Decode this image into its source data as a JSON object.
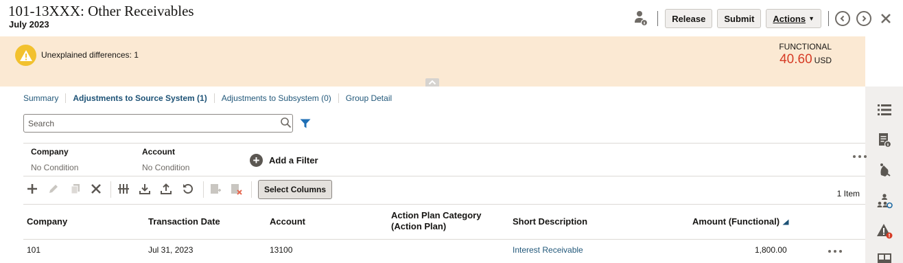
{
  "header": {
    "title": "101-13XXX: Other Receivables",
    "period": "July 2023",
    "buttons": {
      "release": "Release",
      "submit": "Submit",
      "actions": "Actions"
    }
  },
  "banner": {
    "message": "Unexplained differences: 1",
    "functional_label": "FUNCTIONAL",
    "functional_value": "40.60",
    "currency": "USD",
    "value_color": "#d63b25"
  },
  "tabs": [
    {
      "label": "Summary",
      "active": false
    },
    {
      "label": "Adjustments to Source System (1)",
      "active": true
    },
    {
      "label": "Adjustments to Subsystem (0)",
      "active": false
    },
    {
      "label": "Group Detail",
      "active": false
    }
  ],
  "search": {
    "placeholder": "Search"
  },
  "filters": [
    {
      "label": "Company",
      "value": "No Condition"
    },
    {
      "label": "Account",
      "value": "No Condition"
    }
  ],
  "add_filter": "Add a Filter",
  "toolbar": {
    "select_columns": "Select Columns",
    "item_count": "1 Item"
  },
  "table": {
    "columns": [
      "Company",
      "Transaction Date",
      "Account",
      "Action Plan Category (Action Plan)",
      "Short Description",
      "Amount (Functional)"
    ],
    "rows": [
      {
        "company": "101",
        "date": "Jul 31, 2023",
        "account": "13100",
        "category": "",
        "description": "Interest Receivable",
        "amount": "1,800.00"
      }
    ]
  },
  "icons": {
    "header": [
      "person-info-icon",
      "previous-icon",
      "next-icon",
      "close-icon"
    ],
    "rail": [
      "list-icon",
      "report-info-icon",
      "bell-icon",
      "hierarchy-icon",
      "alert-icon",
      "panel-icon"
    ],
    "toolbar": [
      "add-icon",
      "edit-icon",
      "copy-icon",
      "delete-icon",
      "freeze-icon",
      "download-icon",
      "upload-icon",
      "refresh-icon",
      "export-icon",
      "clear-icon"
    ]
  }
}
